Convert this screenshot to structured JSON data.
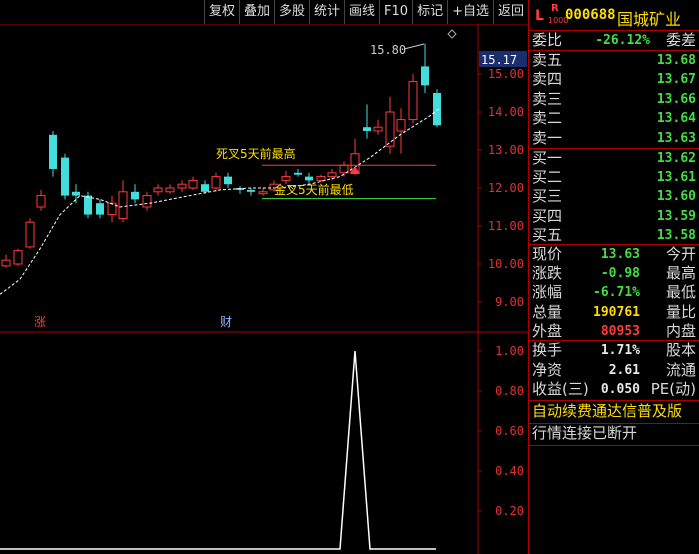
{
  "toolbar": {
    "buttons": [
      "复权",
      "叠加",
      "多股",
      "统计",
      "画线",
      "F10",
      "标记",
      "+自选",
      "返回"
    ]
  },
  "chart": {
    "top_annotation": "15.80",
    "price_tag": "15.17",
    "y_ticks": [
      "15.00",
      "14.00",
      "13.00",
      "12.00",
      "11.00",
      "10.00",
      "9.00"
    ],
    "indicator_ticks": [
      "1.00",
      "0.80",
      "0.60",
      "0.40",
      "0.20"
    ],
    "text_death_cross": "死叉5天前最高",
    "text_golden_cross": "金叉5天前最低",
    "marker_zhang": "涨",
    "marker_cai": "财",
    "colors": {
      "up": "#ff3b3b",
      "down": "#44dddd",
      "ma": "#ffffff",
      "axis": "#aa0000"
    }
  },
  "panel": {
    "flag_l": "L",
    "flag_r": "R",
    "flag_r_sub": "1000",
    "stock_code": "000688",
    "stock_name": "国城矿业",
    "weibi_label": "委比",
    "weibi_value": "-26.12%",
    "weicha_label": "委差",
    "asks": [
      {
        "label": "卖五",
        "price": "13.68"
      },
      {
        "label": "卖四",
        "price": "13.67"
      },
      {
        "label": "卖三",
        "price": "13.66"
      },
      {
        "label": "卖二",
        "price": "13.64"
      },
      {
        "label": "卖一",
        "price": "13.63"
      }
    ],
    "bids": [
      {
        "label": "买一",
        "price": "13.62"
      },
      {
        "label": "买二",
        "price": "13.61"
      },
      {
        "label": "买三",
        "price": "13.60"
      },
      {
        "label": "买四",
        "price": "13.59"
      },
      {
        "label": "买五",
        "price": "13.58"
      }
    ],
    "stats": [
      {
        "label": "现价",
        "value": "13.63",
        "label2": "今开",
        "color": "#44dd44"
      },
      {
        "label": "涨跌",
        "value": "-0.98",
        "label2": "最高",
        "color": "#44dd44"
      },
      {
        "label": "涨幅",
        "value": "-6.71%",
        "label2": "最低",
        "color": "#44dd44"
      },
      {
        "label": "总量",
        "value": "190761",
        "label2": "量比",
        "color": "#ffdd00"
      },
      {
        "label": "外盘",
        "value": "80953",
        "label2": "内盘",
        "color": "#ff3b3b"
      }
    ],
    "stats2": [
      {
        "label": "换手",
        "value": "1.71%",
        "label2": "股本"
      },
      {
        "label": "净资",
        "value": "2.61",
        "label2": "流通"
      },
      {
        "label": "收益(三)",
        "value": "0.050",
        "label2": "PE(动)"
      }
    ],
    "promo": "自动续费通达信普及版",
    "status": "行情连接已断开"
  }
}
